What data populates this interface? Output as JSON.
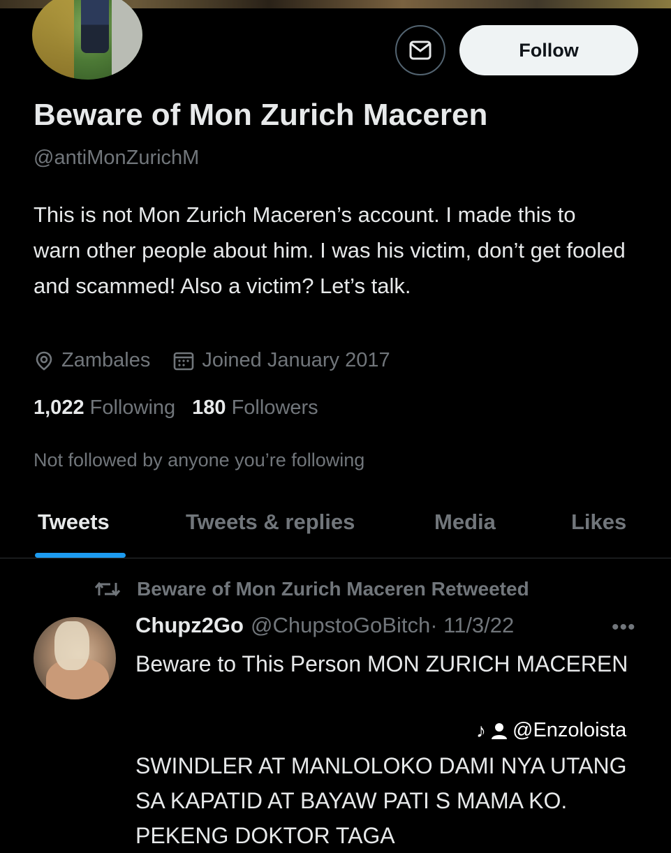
{
  "profile": {
    "name": "Beware of Mon Zurich Maceren",
    "handle": "@antiMonZurichM",
    "bio": "This is not Mon Zurich Maceren’s account. I made this to warn other people about him. I was his victim, don’t get fooled and scammed! Also a victim? Let’s talk.",
    "location": "Zambales",
    "joined": "Joined January 2017",
    "following_count": "1,022",
    "following_label": "Following",
    "followers_count": "180",
    "followers_label": "Followers",
    "not_followed": "Not followed by anyone you’re following"
  },
  "actions": {
    "message_icon": "mail-icon",
    "follow_label": "Follow"
  },
  "tabs": [
    {
      "label": "Tweets",
      "active": true
    },
    {
      "label": "Tweets & replies",
      "active": false
    },
    {
      "label": "Media",
      "active": false
    },
    {
      "label": "Likes",
      "active": false
    }
  ],
  "tweet": {
    "retweeted_by": "Beware of Mon Zurich Maceren Retweeted",
    "author_name": "Chupz2Go",
    "author_handle": "@ChupstoGoBitch",
    "date": "· 11/3/22",
    "more": "•••",
    "text1": "Beware to This Person MON ZURICH MACEREN",
    "text2": "SWINDLER AT MANLOLOKO DAMI NYA UTANG SA KAPATID AT BAYAW PATI S MAMA KO. PEKENG DOKTOR TAGA"
  },
  "watermark": {
    "handle": "@Enzoloista"
  },
  "colors": {
    "background": "#000000",
    "text": "#e7e9ea",
    "muted": "#71767b",
    "accent": "#1d9bf0",
    "follow_bg": "#eff3f4"
  }
}
